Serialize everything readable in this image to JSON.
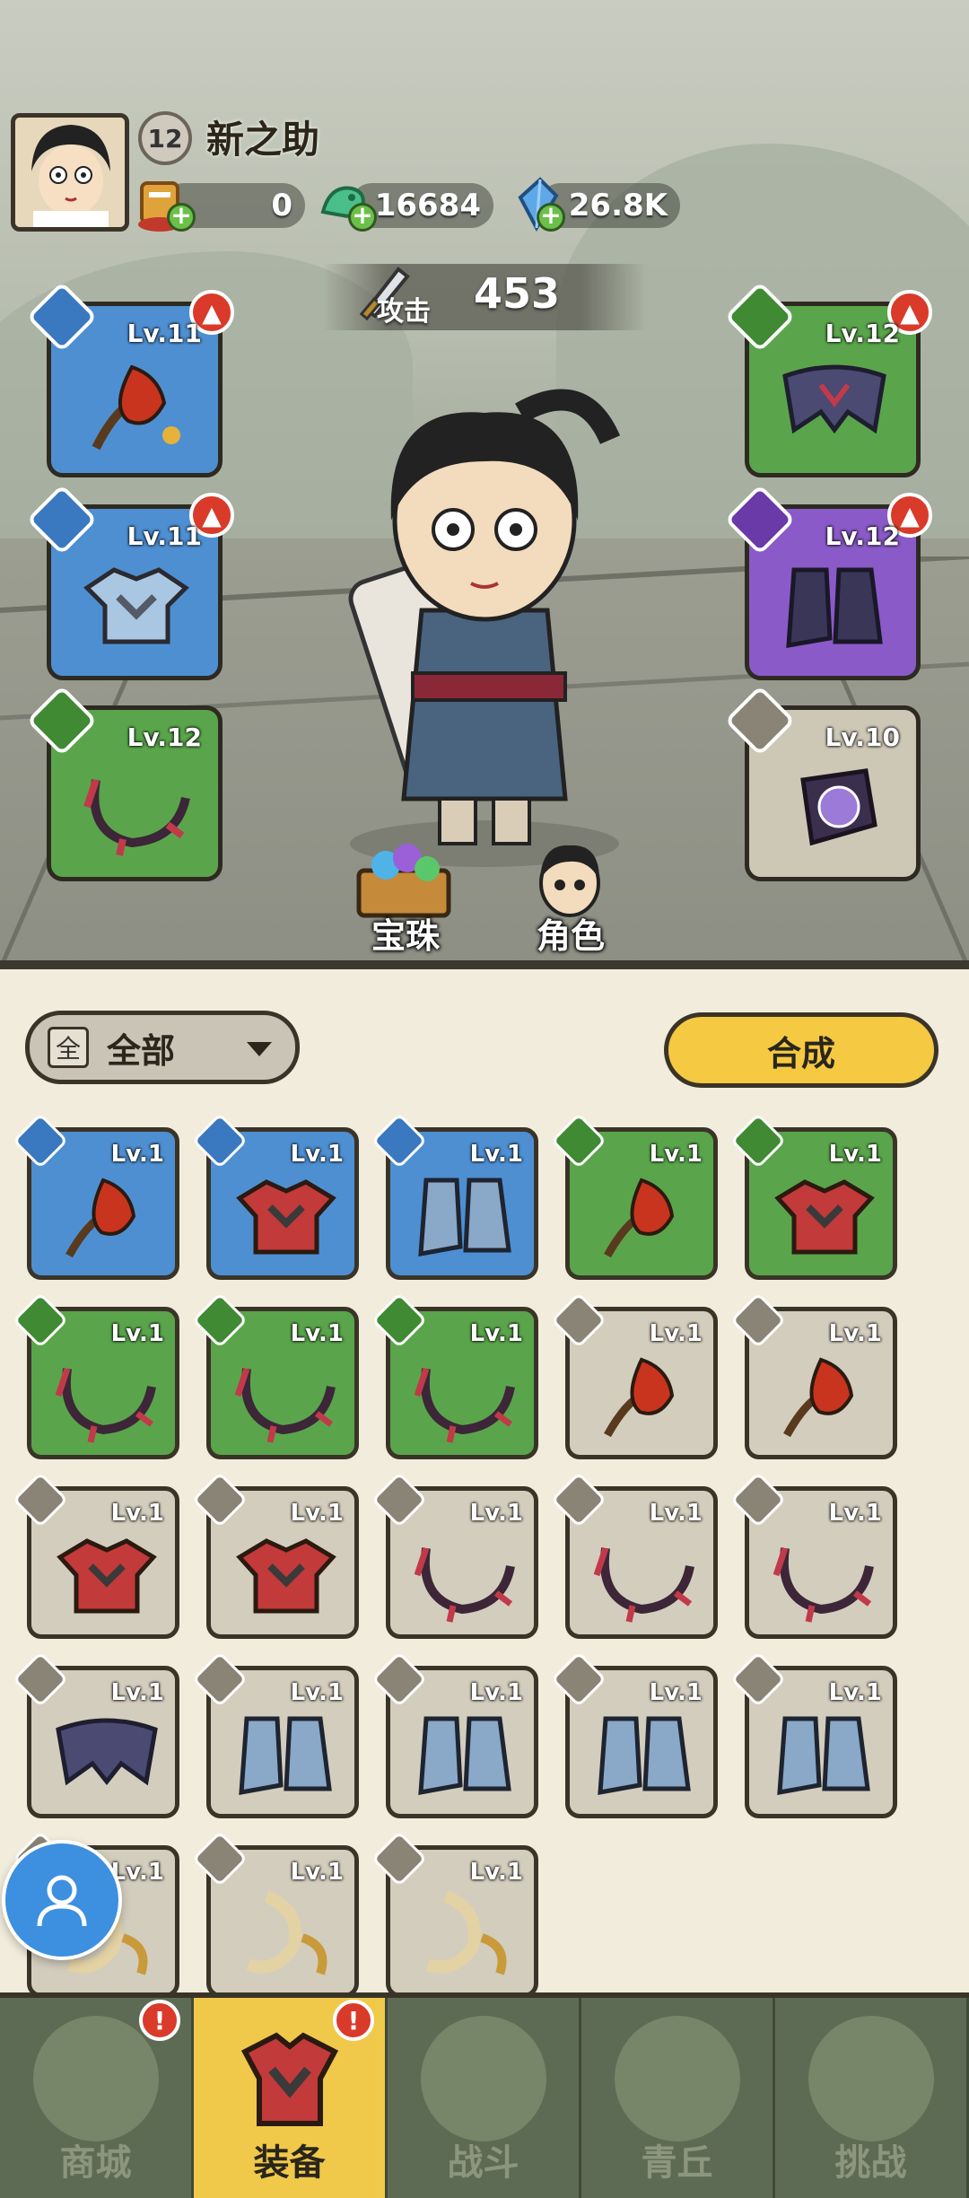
{
  "player": {
    "level": "12",
    "name": "新之助"
  },
  "currencies": [
    {
      "name": "ticket",
      "value": "0",
      "icon": "ticket-icon"
    },
    {
      "name": "jade",
      "value": "16684",
      "icon": "jade-dragon-icon"
    },
    {
      "name": "crystal",
      "value": "26.8K",
      "icon": "crystal-icon"
    }
  ],
  "attack": {
    "label": "攻击",
    "value": "453"
  },
  "equipped": {
    "left": [
      {
        "level": "Lv.11",
        "rarity": "blue",
        "slot": "weapon",
        "upgrade": true
      },
      {
        "level": "Lv.11",
        "rarity": "blue",
        "slot": "armor",
        "upgrade": true
      },
      {
        "level": "Lv.12",
        "rarity": "green",
        "slot": "necklace",
        "upgrade": false
      }
    ],
    "right": [
      {
        "level": "Lv.12",
        "rarity": "green",
        "slot": "belt",
        "upgrade": true
      },
      {
        "level": "Lv.12",
        "rarity": "purple",
        "slot": "boots",
        "upgrade": true
      },
      {
        "level": "Lv.10",
        "rarity": "gray",
        "slot": "ring",
        "upgrade": false
      }
    ]
  },
  "scene_buttons": {
    "gems": "宝珠",
    "character": "角色"
  },
  "filter": {
    "icon_text": "全",
    "label": "全部"
  },
  "combine_label": "合成",
  "inventory": [
    {
      "level": "Lv.1",
      "rarity": "blue",
      "slot": "weapon"
    },
    {
      "level": "Lv.1",
      "rarity": "blue",
      "slot": "armor"
    },
    {
      "level": "Lv.1",
      "rarity": "blue",
      "slot": "boots"
    },
    {
      "level": "Lv.1",
      "rarity": "green",
      "slot": "weapon"
    },
    {
      "level": "Lv.1",
      "rarity": "green",
      "slot": "armor"
    },
    {
      "level": "Lv.1",
      "rarity": "green",
      "slot": "necklace"
    },
    {
      "level": "Lv.1",
      "rarity": "green",
      "slot": "necklace"
    },
    {
      "level": "Lv.1",
      "rarity": "green",
      "slot": "necklace"
    },
    {
      "level": "Lv.1",
      "rarity": "gray",
      "slot": "weapon"
    },
    {
      "level": "Lv.1",
      "rarity": "gray",
      "slot": "weapon"
    },
    {
      "level": "Lv.1",
      "rarity": "gray",
      "slot": "armor"
    },
    {
      "level": "Lv.1",
      "rarity": "gray",
      "slot": "armor"
    },
    {
      "level": "Lv.1",
      "rarity": "gray",
      "slot": "necklace"
    },
    {
      "level": "Lv.1",
      "rarity": "gray",
      "slot": "necklace"
    },
    {
      "level": "Lv.1",
      "rarity": "gray",
      "slot": "necklace"
    },
    {
      "level": "Lv.1",
      "rarity": "gray",
      "slot": "belt"
    },
    {
      "level": "Lv.1",
      "rarity": "gray",
      "slot": "boots"
    },
    {
      "level": "Lv.1",
      "rarity": "gray",
      "slot": "boots"
    },
    {
      "level": "Lv.1",
      "rarity": "gray",
      "slot": "boots"
    },
    {
      "level": "Lv.1",
      "rarity": "gray",
      "slot": "boots"
    },
    {
      "level": "Lv.1",
      "rarity": "gray",
      "slot": "ring"
    },
    {
      "level": "Lv.1",
      "rarity": "gray",
      "slot": "ring"
    },
    {
      "level": "Lv.1",
      "rarity": "gray",
      "slot": "ring"
    }
  ],
  "nav": [
    {
      "label": "商城",
      "active": false,
      "alert": true,
      "icon": "shop-icon"
    },
    {
      "label": "装备",
      "active": true,
      "alert": true,
      "icon": "equipment-icon"
    },
    {
      "label": "战斗",
      "active": false,
      "alert": false,
      "icon": "battle-icon"
    },
    {
      "label": "青丘",
      "active": false,
      "alert": false,
      "icon": "qingqiu-icon"
    },
    {
      "label": "挑战",
      "active": false,
      "alert": false,
      "icon": "challenge-icon"
    }
  ],
  "colors": {
    "blue": "#4e8fd2",
    "green": "#5aa54b",
    "purple": "#8a5ac8",
    "gray": "#d3cdbd",
    "accent": "#f5c942",
    "alert": "#d93a2a"
  }
}
